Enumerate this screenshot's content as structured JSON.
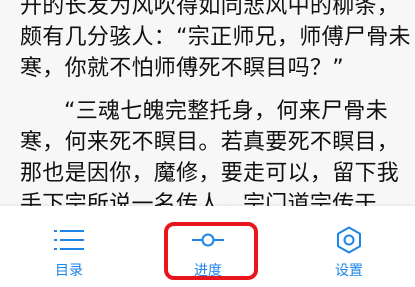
{
  "content": {
    "lines": [
      "开的长发为风吹得如同悲风中的柳条，",
      "颇有几分骇人：“宗正师兄，师傅尸骨未",
      "寒，你就不怕师傅死不瞑目吗？”",
      "“三魂七魄完整托身，何来尸骨未",
      "寒，何来死不瞑目。若真要死不瞑目，",
      "那也是因你，魔修，要走可以，留下我",
      "手下宗所说一名传人，宗门道宗传于"
    ]
  },
  "bottom_nav": {
    "toc_label": "目录",
    "progress_label": "进度",
    "settings_label": "设置"
  },
  "colors": {
    "accent": "#1e86e8",
    "highlight": "#e8161c",
    "text": "#111111"
  }
}
